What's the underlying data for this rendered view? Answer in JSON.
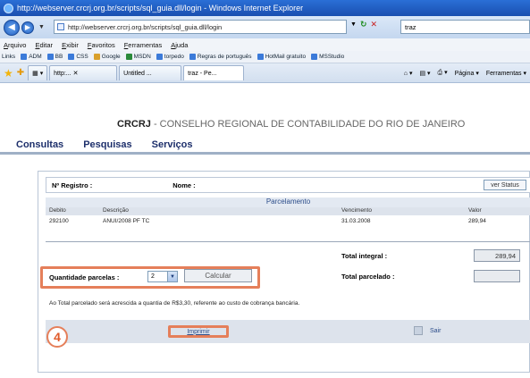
{
  "window": {
    "title": "http://webserver.crcrj.org.br/scripts/sql_guia.dll/login - Windows Internet Explorer"
  },
  "address_bar": {
    "url": "http://webserver.crcrj.org.br/scripts/sql_guia.dll/login",
    "search_value": "traz"
  },
  "menu": [
    "Arquivo",
    "Editar",
    "Exibir",
    "Favoritos",
    "Ferramentas",
    "Ajuda"
  ],
  "links": {
    "label": "Links",
    "items": [
      "ADM",
      "BB",
      "CSS",
      "Google",
      "MSDN",
      "torpedo",
      "Regras de português",
      "HotMail gratuito",
      "MSStudio"
    ]
  },
  "tabs": {
    "items": [
      "http:...",
      "Untitled ...",
      "traz - Pe..."
    ],
    "tools": [
      "Página ▾",
      "Ferramentas ▾"
    ]
  },
  "site": {
    "brand_bold": "CRCRJ",
    "brand_rest": " - CONSELHO REGIONAL DE CONTABILIDADE DO RIO DE JANEIRO",
    "nav": [
      "Consultas",
      "Pesquisas",
      "Serviços"
    ]
  },
  "form": {
    "registro_label": "Nº Registro :",
    "nome_label": "Nome :",
    "ver_status": "ver Status",
    "parcelamento_title": "Parcelamento",
    "columns": [
      "Debito",
      "Descrição",
      "Vencimento",
      "Valor"
    ],
    "rows": [
      [
        "292100",
        "ANUI/2008 PF TC",
        "31.03.2008",
        "289,94"
      ]
    ],
    "total_integral_label": "Total integral :",
    "total_integral_value": "289,94",
    "total_parcelado_label": "Total parcelado :",
    "total_parcelado_value": "",
    "qty_label": "Quantidade parcelas :",
    "qty_value": "2",
    "calc_label": "Calcular",
    "note": "Ao Total parcelado será acrescida a quantia de R$3,30, referente ao custo de cobrança bancária.",
    "step_badge": "4",
    "imprimir": "Imprimir",
    "sair": "Sair"
  }
}
